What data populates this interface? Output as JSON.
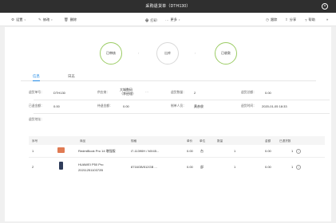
{
  "window": {
    "title": "采购退货单（DTH130）"
  },
  "toolbar": {
    "left": [
      {
        "icon": "gear-icon",
        "glyph": "⚙",
        "label": "设置",
        "has_caret": true
      },
      {
        "icon": "settings-icon",
        "glyph": "✎",
        "label": "修改",
        "has_caret": true
      },
      {
        "icon": "trash-icon",
        "glyph": "🗑",
        "label": "删除",
        "has_caret": false
      },
      {
        "icon": "print-icon",
        "glyph": "🖶",
        "label": "打印",
        "has_caret": false
      },
      {
        "icon": "more-icon",
        "glyph": "···",
        "label": "更多",
        "has_caret": true
      }
    ],
    "right": [
      {
        "icon": "clock-icon",
        "glyph": "◷",
        "label": "跟踪"
      },
      {
        "icon": "share-icon",
        "glyph": "⇪",
        "label": "分享"
      },
      {
        "icon": "help-icon",
        "glyph": "?",
        "label": "帮助"
      }
    ],
    "expand": "»"
  },
  "steps": [
    {
      "label": "已审核",
      "state": "done"
    },
    {
      "label": "出库",
      "state": "todo"
    },
    {
      "label": "已收款",
      "state": "done"
    }
  ],
  "step_arrow": "›",
  "tabs": [
    {
      "label": "信息",
      "active": true
    },
    {
      "label": "日志",
      "active": false
    }
  ],
  "info": {
    "row1": [
      {
        "label": "退货单号：",
        "value": "DTH130"
      },
      {
        "label": "供应商：",
        "value": "大城数码\n（李经理）",
        "extra": "···"
      },
      {
        "label": "退货数量：",
        "value": "2"
      },
      {
        "label": "退货总额：",
        "value": "0.00"
      }
    ],
    "row2": [
      {
        "label": "已退金额：",
        "value": "0.00"
      },
      {
        "label": "待退金额：",
        "value": "0.00"
      },
      {
        "label": "制单人员：",
        "value": "黄彦俊"
      },
      {
        "label": "退货时间：",
        "value": "2020-01-05 18:33"
      }
    ],
    "row3": [
      {
        "label": "退货地址：",
        "value": ""
      }
    ]
  },
  "table": {
    "headers": [
      "序号",
      "商品",
      "规格",
      "单价",
      "单位",
      "数量",
      "金额",
      "已退货数"
    ],
    "rows": [
      {
        "index": "1",
        "thumb_color": "#e07b53",
        "name": "RedmiBook Pro 14 增强版",
        "spec": "i7-11390H / MX45...",
        "price": "0.00",
        "unit": "台",
        "qty": "1",
        "amount": "0.00",
        "returned": "1"
      },
      {
        "index": "2",
        "thumb_color": "#2f3c5a",
        "name": "HUAWEI P50 Pro\n2021125110372B",
        "spec": "8716GB/512GB ...",
        "price": "0.00",
        "unit": "部",
        "qty": "1",
        "amount": "0.00",
        "returned": "1"
      }
    ],
    "row_action_glyph": "i"
  }
}
